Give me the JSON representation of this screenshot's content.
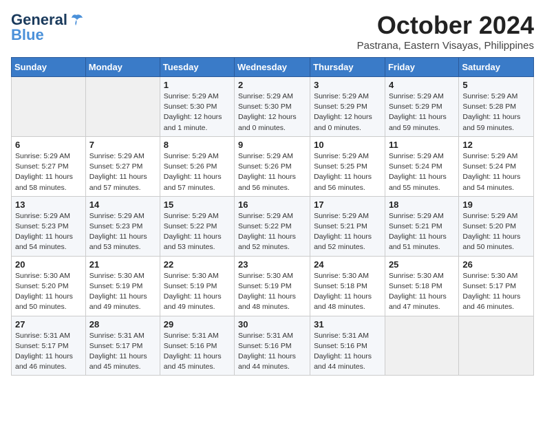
{
  "header": {
    "logo_general": "General",
    "logo_blue": "Blue",
    "month_title": "October 2024",
    "location": "Pastrana, Eastern Visayas, Philippines"
  },
  "days_of_week": [
    "Sunday",
    "Monday",
    "Tuesday",
    "Wednesday",
    "Thursday",
    "Friday",
    "Saturday"
  ],
  "weeks": [
    [
      {
        "day": "",
        "info": ""
      },
      {
        "day": "",
        "info": ""
      },
      {
        "day": "1",
        "info": "Sunrise: 5:29 AM\nSunset: 5:30 PM\nDaylight: 12 hours\nand 1 minute."
      },
      {
        "day": "2",
        "info": "Sunrise: 5:29 AM\nSunset: 5:30 PM\nDaylight: 12 hours\nand 0 minutes."
      },
      {
        "day": "3",
        "info": "Sunrise: 5:29 AM\nSunset: 5:29 PM\nDaylight: 12 hours\nand 0 minutes."
      },
      {
        "day": "4",
        "info": "Sunrise: 5:29 AM\nSunset: 5:29 PM\nDaylight: 11 hours\nand 59 minutes."
      },
      {
        "day": "5",
        "info": "Sunrise: 5:29 AM\nSunset: 5:28 PM\nDaylight: 11 hours\nand 59 minutes."
      }
    ],
    [
      {
        "day": "6",
        "info": "Sunrise: 5:29 AM\nSunset: 5:27 PM\nDaylight: 11 hours\nand 58 minutes."
      },
      {
        "day": "7",
        "info": "Sunrise: 5:29 AM\nSunset: 5:27 PM\nDaylight: 11 hours\nand 57 minutes."
      },
      {
        "day": "8",
        "info": "Sunrise: 5:29 AM\nSunset: 5:26 PM\nDaylight: 11 hours\nand 57 minutes."
      },
      {
        "day": "9",
        "info": "Sunrise: 5:29 AM\nSunset: 5:26 PM\nDaylight: 11 hours\nand 56 minutes."
      },
      {
        "day": "10",
        "info": "Sunrise: 5:29 AM\nSunset: 5:25 PM\nDaylight: 11 hours\nand 56 minutes."
      },
      {
        "day": "11",
        "info": "Sunrise: 5:29 AM\nSunset: 5:24 PM\nDaylight: 11 hours\nand 55 minutes."
      },
      {
        "day": "12",
        "info": "Sunrise: 5:29 AM\nSunset: 5:24 PM\nDaylight: 11 hours\nand 54 minutes."
      }
    ],
    [
      {
        "day": "13",
        "info": "Sunrise: 5:29 AM\nSunset: 5:23 PM\nDaylight: 11 hours\nand 54 minutes."
      },
      {
        "day": "14",
        "info": "Sunrise: 5:29 AM\nSunset: 5:23 PM\nDaylight: 11 hours\nand 53 minutes."
      },
      {
        "day": "15",
        "info": "Sunrise: 5:29 AM\nSunset: 5:22 PM\nDaylight: 11 hours\nand 53 minutes."
      },
      {
        "day": "16",
        "info": "Sunrise: 5:29 AM\nSunset: 5:22 PM\nDaylight: 11 hours\nand 52 minutes."
      },
      {
        "day": "17",
        "info": "Sunrise: 5:29 AM\nSunset: 5:21 PM\nDaylight: 11 hours\nand 52 minutes."
      },
      {
        "day": "18",
        "info": "Sunrise: 5:29 AM\nSunset: 5:21 PM\nDaylight: 11 hours\nand 51 minutes."
      },
      {
        "day": "19",
        "info": "Sunrise: 5:29 AM\nSunset: 5:20 PM\nDaylight: 11 hours\nand 50 minutes."
      }
    ],
    [
      {
        "day": "20",
        "info": "Sunrise: 5:30 AM\nSunset: 5:20 PM\nDaylight: 11 hours\nand 50 minutes."
      },
      {
        "day": "21",
        "info": "Sunrise: 5:30 AM\nSunset: 5:19 PM\nDaylight: 11 hours\nand 49 minutes."
      },
      {
        "day": "22",
        "info": "Sunrise: 5:30 AM\nSunset: 5:19 PM\nDaylight: 11 hours\nand 49 minutes."
      },
      {
        "day": "23",
        "info": "Sunrise: 5:30 AM\nSunset: 5:19 PM\nDaylight: 11 hours\nand 48 minutes."
      },
      {
        "day": "24",
        "info": "Sunrise: 5:30 AM\nSunset: 5:18 PM\nDaylight: 11 hours\nand 48 minutes."
      },
      {
        "day": "25",
        "info": "Sunrise: 5:30 AM\nSunset: 5:18 PM\nDaylight: 11 hours\nand 47 minutes."
      },
      {
        "day": "26",
        "info": "Sunrise: 5:30 AM\nSunset: 5:17 PM\nDaylight: 11 hours\nand 46 minutes."
      }
    ],
    [
      {
        "day": "27",
        "info": "Sunrise: 5:31 AM\nSunset: 5:17 PM\nDaylight: 11 hours\nand 46 minutes."
      },
      {
        "day": "28",
        "info": "Sunrise: 5:31 AM\nSunset: 5:17 PM\nDaylight: 11 hours\nand 45 minutes."
      },
      {
        "day": "29",
        "info": "Sunrise: 5:31 AM\nSunset: 5:16 PM\nDaylight: 11 hours\nand 45 minutes."
      },
      {
        "day": "30",
        "info": "Sunrise: 5:31 AM\nSunset: 5:16 PM\nDaylight: 11 hours\nand 44 minutes."
      },
      {
        "day": "31",
        "info": "Sunrise: 5:31 AM\nSunset: 5:16 PM\nDaylight: 11 hours\nand 44 minutes."
      },
      {
        "day": "",
        "info": ""
      },
      {
        "day": "",
        "info": ""
      }
    ]
  ]
}
